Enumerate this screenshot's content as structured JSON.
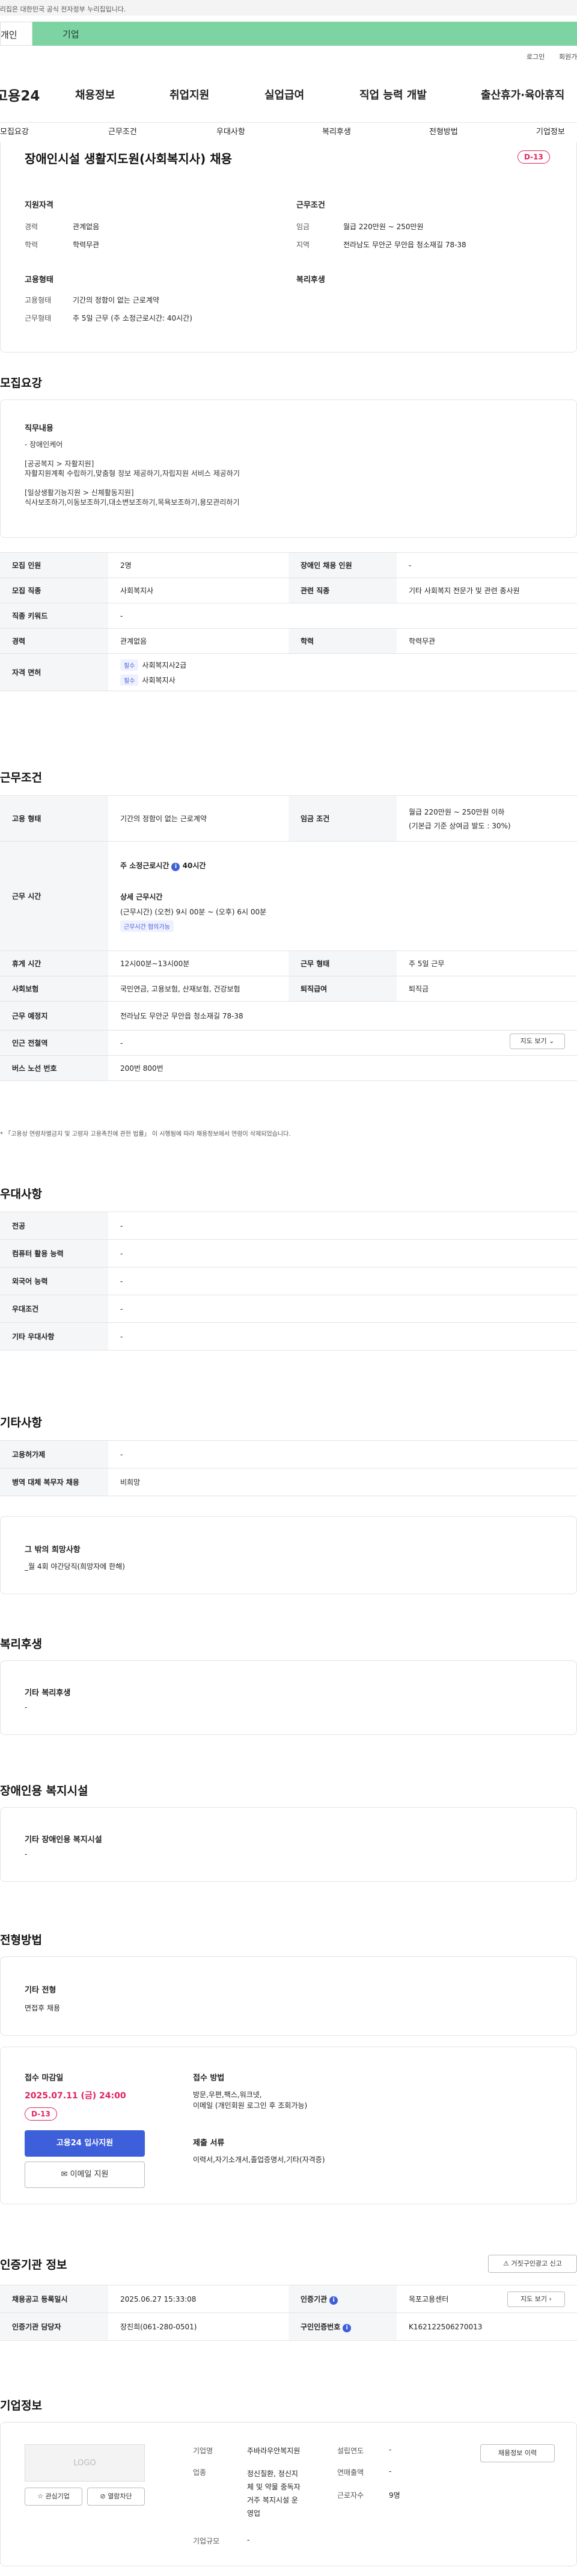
{
  "gov_banner": "이 누리집은 대한민국 공식 전자정부 누리집입니다.",
  "tabs": {
    "left": "개인",
    "right": "기업"
  },
  "util": {
    "login": "로그인",
    "join": "회원가입"
  },
  "logo": "고용24",
  "main_nav": [
    "채용정보",
    "취업지원",
    "실업급여",
    "직업 능력 개발",
    "출산휴가·육아휴직"
  ],
  "sub_nav": [
    "모집요강",
    "근무조건",
    "우대사항",
    "복리후생",
    "전형방법",
    "기업정보"
  ],
  "summary": {
    "title": "장애인시설 생활지도원(사회복지사) 채용",
    "dday": "D-13",
    "qual_title": "지원자격",
    "career_label": "경력",
    "career_value": "관계없음",
    "edu_label": "학력",
    "edu_value": "학력무관",
    "emp_title": "고용형태",
    "emp_label": "고용형태",
    "emp_value": "기간의 정함이 없는 근로계약",
    "work_label": "근무형태",
    "work_value": "주 5일 근무 (주 소정근로시간: 40시간)",
    "cond_title": "근무조건",
    "wage_label": "임금",
    "wage_value": "월급 220만원 ~ 250만원",
    "region_label": "지역",
    "region_value": "전라남도 무안군 무안읍 청소재길 78-38",
    "welfare_title": "복리후생"
  },
  "recruit": {
    "title": "모집요강",
    "duty_title": "직무내용",
    "duty_lines": [
      "- 장애인케어",
      "",
      "[공공복지 > 자활지원]",
      "자활지원계획 수립하기,맞춤형 정보 제공하기,자립지원 서비스 제공하기",
      "",
      "[일상생활기능지원 > 신체활동지원]",
      "식사보조하기,이동보조하기,대소변보조하기,목욕보조하기,용모관리하기"
    ],
    "rows": {
      "headcount_label": "모집 인원",
      "headcount_value": "2명",
      "disabled_label": "장애인 채용 인원",
      "disabled_value": "-",
      "job_label": "모집 직종",
      "job_value": "사회복지사",
      "related_label": "관련 직종",
      "related_value": "기타 사회복지 전문가 및 관련 종사원",
      "keyword_label": "직종 키워드",
      "keyword_value": "-",
      "career_label": "경력",
      "career_value": "관계없음",
      "edu_label": "학력",
      "edu_value": "학력무관",
      "license_label": "자격 면허",
      "license_chip": "필수",
      "license_1": "사회복지사2급",
      "license_2": "사회복지사"
    }
  },
  "conditions": {
    "title": "근무조건",
    "emp_label": "고용 형태",
    "emp_value": "기간의 정함이 없는 근로계약",
    "wage_label": "임금 조건",
    "wage_value": "월급 220만원 ~ 250만원 이하",
    "wage_note": "(기본급 기준 상여금 발도 : 30%)",
    "hours_label": "근무 시간",
    "hours_week": "주 소정근로시간",
    "hours_week_value": "40시간",
    "hours_detail_title": "상세 근무시간",
    "hours_detail": "(근무시간) (오전) 9시 00분 ~ (오후) 6시 00분",
    "hours_chip": "근무시간 협의가능",
    "break_label": "휴게 시간",
    "break_value": "12시00분~13시00분",
    "type_label": "근무 형태",
    "type_value": "주 5일 근무",
    "ins_label": "사회보험",
    "ins_value": "국민연금, 고용보험, 산재보험, 건강보험",
    "retire_label": "퇴직급여",
    "retire_value": "퇴직금",
    "place_label": "근무 예정지",
    "place_value": "전라남도 무안군 무안읍 청소재길 78-38",
    "map_btn": "지도 보기",
    "subway_label": "인근 전철역",
    "subway_value": "-",
    "bus_label": "버스 노선 번호",
    "bus_value": "200번 800번",
    "notice": "「고용상 연령차별금지 및 고령자 고용촉진에 관한 법률」 이 시행됨에 따라 채용정보에서 연령이 삭제되었습니다."
  },
  "pref": {
    "title": "우대사항",
    "rows": [
      {
        "label": "전공",
        "value": "-"
      },
      {
        "label": "컴퓨터 활용 능력",
        "value": "-"
      },
      {
        "label": "외국어 능력",
        "value": "-"
      },
      {
        "label": "우대조건",
        "value": "-"
      },
      {
        "label": "기타 우대사항",
        "value": "-"
      }
    ]
  },
  "etc": {
    "title": "기타사항",
    "rows": [
      {
        "label": "고용허가제",
        "value": "-"
      },
      {
        "label": "병역 대체 복무자 채용",
        "value": "비희망"
      }
    ],
    "hope_title": "그 밖의 희망사항",
    "hope_value": "_월 4회 야간당직(희망자에 한해)"
  },
  "welfare": {
    "title": "복리후생",
    "sub": "기타 복리후생",
    "value": "-"
  },
  "facility": {
    "title": "장애인용 복지시설",
    "sub": "기타 장애인용 복지시설",
    "value": "-"
  },
  "screening": {
    "title": "전형방법",
    "sub": "기타 전형",
    "value": "면접후 채용",
    "deadline_label": "접수 마감일",
    "deadline_value": "2025.07.11 (금) 24:00",
    "dday": "D-13",
    "apply_btn": "고용24 입사지원",
    "email_btn": "이메일 지원",
    "method_label": "접수 방법",
    "method_value_1": "방문,우편,팩스,워크넷,",
    "method_value_2": "이메일 (개인회원 로그인 후 조회가능)",
    "docs_label": "제출 서류",
    "docs_value": "이력서,자기소개서,졸업증명서,기타(자격증)"
  },
  "agency": {
    "title": "인증기관 정보",
    "report_btn": "거짓구인광고 신고",
    "reg_label": "채용공고 등록일시",
    "reg_value": "2025.06.27 15:33:08",
    "org_label": "인증기관",
    "org_value": "목포고용센터",
    "map_btn": "지도 보기",
    "mgr_label": "인증기관 담당자",
    "mgr_value": "장진희(061-280-0501)",
    "num_label": "구인인증번호",
    "num_value": "K162122506270013"
  },
  "company": {
    "title": "기업정보",
    "logo": "LOGO",
    "fav_btn": "관심기업",
    "block_btn": "열람차단",
    "history_btn": "채용정보 이력",
    "name_label": "기업명",
    "name_value": "주바라우안복지원",
    "ind_label": "업종",
    "ind_value_1": "정신질환, 정신지",
    "ind_value_2": "체 및 약물 중독자",
    "ind_value_3": "거주 복지시설 운",
    "ind_value_4": "영업",
    "size_label": "기업규모",
    "size_value": "-",
    "year_label": "설립연도",
    "year_value": "-",
    "sales_label": "연매출액",
    "sales_value": "-",
    "emp_label": "근로자수",
    "emp_value": "9명"
  }
}
